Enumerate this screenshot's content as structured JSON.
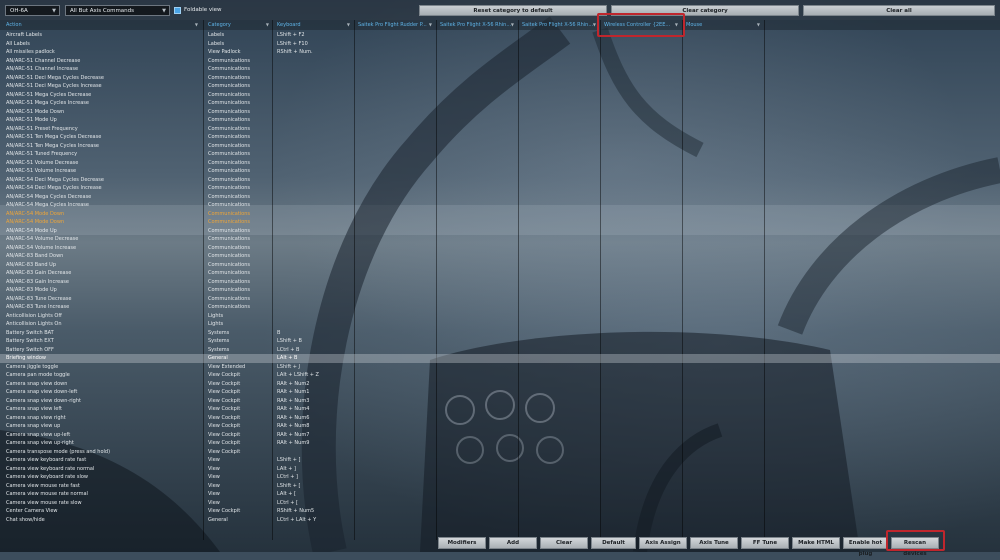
{
  "toolbar": {
    "aircraft_select": "OH-6A",
    "filter_select": "All But Axis Commands",
    "foldable_view_label": "Foldable view",
    "reset_category_label": "Reset category to default",
    "clear_category_label": "Clear category",
    "clear_all_label": "Clear all"
  },
  "columns": {
    "action": "Action",
    "category": "Category",
    "keyboard": "Keyboard",
    "device1": "Saitek Pro Flight Rudder P...",
    "device2": "Saitek Pro Flight X-56 Rhin...",
    "device3": "Saitek Pro Flight X-56 Rhin...",
    "device4": "Wireless Controller {2EE...",
    "device5": "Mouse"
  },
  "rows": [
    {
      "action": "Aircraft Labels",
      "category": "Labels",
      "keyboard": "LShift + F2"
    },
    {
      "action": "All Labels",
      "category": "Labels",
      "keyboard": "LShift + F10"
    },
    {
      "action": "All missiles padlock",
      "category": "View Padlock",
      "keyboard": "RShift + Num."
    },
    {
      "action": "AN/ARC-51 Channel Decrease",
      "category": "Communications",
      "keyboard": ""
    },
    {
      "action": "AN/ARC-51 Channel Increase",
      "category": "Communications",
      "keyboard": ""
    },
    {
      "action": "AN/ARC-51 Deci Mega Cycles Decrease",
      "category": "Communications",
      "keyboard": ""
    },
    {
      "action": "AN/ARC-51 Deci Mega Cycles Increase",
      "category": "Communications",
      "keyboard": ""
    },
    {
      "action": "AN/ARC-51 Mega Cycles Decrease",
      "category": "Communications",
      "keyboard": ""
    },
    {
      "action": "AN/ARC-51 Mega Cycles Increase",
      "category": "Communications",
      "keyboard": ""
    },
    {
      "action": "AN/ARC-51 Mode Down",
      "category": "Communications",
      "keyboard": ""
    },
    {
      "action": "AN/ARC-51 Mode Up",
      "category": "Communications",
      "keyboard": ""
    },
    {
      "action": "AN/ARC-51 Preset Frequency",
      "category": "Communications",
      "keyboard": ""
    },
    {
      "action": "AN/ARC-51 Ten Mega Cycles Decrease",
      "category": "Communications",
      "keyboard": ""
    },
    {
      "action": "AN/ARC-51 Ten Mega Cycles Increase",
      "category": "Communications",
      "keyboard": ""
    },
    {
      "action": "AN/ARC-51 Tuned Frequency",
      "category": "Communications",
      "keyboard": ""
    },
    {
      "action": "AN/ARC-51 Volume Decrease",
      "category": "Communications",
      "keyboard": ""
    },
    {
      "action": "AN/ARC-51 Volume Increase",
      "category": "Communications",
      "keyboard": ""
    },
    {
      "action": "AN/ARC-54 Deci Mega Cycles Decrease",
      "category": "Communications",
      "keyboard": ""
    },
    {
      "action": "AN/ARC-54 Deci Mega Cycles Increase",
      "category": "Communications",
      "keyboard": ""
    },
    {
      "action": "AN/ARC-54 Mega Cycles Decrease",
      "category": "Communications",
      "keyboard": ""
    },
    {
      "action": "AN/ARC-54 Mega Cycles Increase",
      "category": "Communications",
      "keyboard": ""
    },
    {
      "action": "AN/ARC-54 Mode Down",
      "category": "Communications",
      "keyboard": "",
      "alt": true
    },
    {
      "action": "AN/ARC-54 Mode Down",
      "category": "Communications",
      "keyboard": "",
      "alt": true
    },
    {
      "action": "AN/ARC-54 Mode Up",
      "category": "Communications",
      "keyboard": ""
    },
    {
      "action": "AN/ARC-54 Volume Decrease",
      "category": "Communications",
      "keyboard": ""
    },
    {
      "action": "AN/ARC-54 Volume Increase",
      "category": "Communications",
      "keyboard": ""
    },
    {
      "action": "AN/ARC-83 Band Down",
      "category": "Communications",
      "keyboard": ""
    },
    {
      "action": "AN/ARC-83 Band Up",
      "category": "Communications",
      "keyboard": ""
    },
    {
      "action": "AN/ARC-83 Gain Decrease",
      "category": "Communications",
      "keyboard": ""
    },
    {
      "action": "AN/ARC-83 Gain Increase",
      "category": "Communications",
      "keyboard": ""
    },
    {
      "action": "AN/ARC-83 Mode Up",
      "category": "Communications",
      "keyboard": ""
    },
    {
      "action": "AN/ARC-83 Tune Decrease",
      "category": "Communications",
      "keyboard": ""
    },
    {
      "action": "AN/ARC-83 Tune Increase",
      "category": "Communications",
      "keyboard": ""
    },
    {
      "action": "Anticollision Lights Off",
      "category": "Lights",
      "keyboard": ""
    },
    {
      "action": "Anticollision Lights On",
      "category": "Lights",
      "keyboard": ""
    },
    {
      "action": "Battery Switch BAT",
      "category": "Systems",
      "keyboard": "B"
    },
    {
      "action": "Battery Switch EXT",
      "category": "Systems",
      "keyboard": "LShift + B"
    },
    {
      "action": "Battery Switch OFF",
      "category": "Systems",
      "keyboard": "LCtrl + B"
    },
    {
      "action": "Briefing window",
      "category": "General",
      "keyboard": "LAlt + B",
      "selected": true
    },
    {
      "action": "Camera jiggle toggle",
      "category": "View Extended",
      "keyboard": "LShift + J"
    },
    {
      "action": "Camera pan mode toggle",
      "category": "View Cockpit",
      "keyboard": "LAlt + LShift + Z"
    },
    {
      "action": "Camera snap view down",
      "category": "View Cockpit",
      "keyboard": "RAlt + Num2"
    },
    {
      "action": "Camera snap view down-left",
      "category": "View Cockpit",
      "keyboard": "RAlt + Num1"
    },
    {
      "action": "Camera snap view down-right",
      "category": "View Cockpit",
      "keyboard": "RAlt + Num3"
    },
    {
      "action": "Camera snap view left",
      "category": "View Cockpit",
      "keyboard": "RAlt + Num4"
    },
    {
      "action": "Camera snap view right",
      "category": "View Cockpit",
      "keyboard": "RAlt + Num6"
    },
    {
      "action": "Camera snap view up",
      "category": "View Cockpit",
      "keyboard": "RAlt + Num8"
    },
    {
      "action": "Camera snap view up-left",
      "category": "View Cockpit",
      "keyboard": "RAlt + Num7"
    },
    {
      "action": "Camera snap view up-right",
      "category": "View Cockpit",
      "keyboard": "RAlt + Num9"
    },
    {
      "action": "Camera transpose mode (press and hold)",
      "category": "View Cockpit",
      "keyboard": ""
    },
    {
      "action": "Camera view keyboard rate fast",
      "category": "View",
      "keyboard": "LShift + ]"
    },
    {
      "action": "Camera view keyboard rate normal",
      "category": "View",
      "keyboard": "LAlt + ]"
    },
    {
      "action": "Camera view keyboard rate slow",
      "category": "View",
      "keyboard": "LCtrl + ]"
    },
    {
      "action": "Camera view mouse rate fast",
      "category": "View",
      "keyboard": "LShift + ["
    },
    {
      "action": "Camera view mouse rate normal",
      "category": "View",
      "keyboard": "LAlt + ["
    },
    {
      "action": "Camera view mouse rate slow",
      "category": "View",
      "keyboard": "LCtrl + ["
    },
    {
      "action": "Center Camera View",
      "category": "View Cockpit",
      "keyboard": "RShift + Num5"
    },
    {
      "action": "Chat show/hide",
      "category": "General",
      "keyboard": "LCtrl + LAlt + Y"
    }
  ],
  "bottom": {
    "modifiers": "Modifiers",
    "add": "Add",
    "clear": "Clear",
    "default": "Default",
    "axis_assign": "Axis Assign",
    "axis_tune": "Axis Tune",
    "ff_tune": "FF Tune",
    "make_html": "Make HTML",
    "enable_hot_plug": "Enable hot plug",
    "rescan_devices": "Rescan devices"
  },
  "colors": {
    "header_text": "#5fb4e8",
    "highlight_row_text": "#f0a637",
    "annotation_box": "#c0262d"
  }
}
